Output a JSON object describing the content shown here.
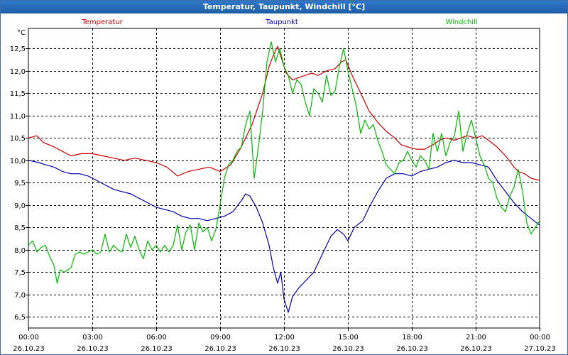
{
  "window": {
    "title": "Temperatur, Taupunkt, Windchill [°C]"
  },
  "chart_data": {
    "type": "line",
    "ylabel": "°C",
    "y_tick_labels": [
      "6,5",
      "7,0",
      "7,5",
      "8,0",
      "8,5",
      "9,0",
      "9,5",
      "10,0",
      "10,5",
      "11,0",
      "11,5",
      "12,0",
      "12,5"
    ],
    "y_ticks": [
      6.5,
      7.0,
      7.5,
      8.0,
      8.5,
      9.0,
      9.5,
      10.0,
      10.5,
      11.0,
      11.5,
      12.0,
      12.5
    ],
    "ylim": [
      6.25,
      12.95
    ],
    "xlim": [
      0,
      24
    ],
    "x_ticks": [
      0,
      3,
      6,
      9,
      12,
      15,
      18,
      21,
      24
    ],
    "x_tick_labels": [
      {
        "time": "00:00",
        "date": "26.10.23"
      },
      {
        "time": "03:00",
        "date": "26.10.23"
      },
      {
        "time": "06:00",
        "date": "26.10.23"
      },
      {
        "time": "09:00",
        "date": "26.10.23"
      },
      {
        "time": "12:00",
        "date": "26.10.23"
      },
      {
        "time": "15:00",
        "date": "26.10.23"
      },
      {
        "time": "18:00",
        "date": "26.10.23"
      },
      {
        "time": "21:00",
        "date": "26.10.23"
      },
      {
        "time": "00:00",
        "date": "27.10.23"
      }
    ],
    "grid": true,
    "legend_position": "top",
    "series": [
      {
        "name": "Temperatur",
        "color": "#cc0000",
        "points": [
          [
            0,
            10.5
          ],
          [
            0.4,
            10.55
          ],
          [
            0.7,
            10.4
          ],
          [
            1.2,
            10.3
          ],
          [
            1.6,
            10.2
          ],
          [
            2.0,
            10.1
          ],
          [
            2.5,
            10.15
          ],
          [
            3.0,
            10.15
          ],
          [
            3.5,
            10.1
          ],
          [
            4.0,
            10.05
          ],
          [
            4.5,
            10.0
          ],
          [
            5.0,
            10.05
          ],
          [
            5.5,
            10.0
          ],
          [
            6.0,
            9.95
          ],
          [
            6.5,
            9.85
          ],
          [
            7.0,
            9.65
          ],
          [
            7.5,
            9.75
          ],
          [
            8.0,
            9.8
          ],
          [
            8.5,
            9.85
          ],
          [
            9.0,
            9.75
          ],
          [
            9.5,
            9.9
          ],
          [
            10.0,
            10.3
          ],
          [
            10.5,
            10.8
          ],
          [
            11.0,
            11.5
          ],
          [
            11.3,
            12.1
          ],
          [
            11.5,
            12.35
          ],
          [
            11.7,
            12.55
          ],
          [
            11.9,
            12.25
          ],
          [
            12.1,
            11.95
          ],
          [
            12.4,
            11.8
          ],
          [
            12.7,
            11.85
          ],
          [
            13.0,
            11.9
          ],
          [
            13.3,
            11.95
          ],
          [
            13.6,
            11.9
          ],
          [
            14.0,
            12.0
          ],
          [
            14.4,
            12.05
          ],
          [
            14.7,
            12.2
          ],
          [
            14.9,
            12.25
          ],
          [
            15.2,
            11.9
          ],
          [
            15.6,
            11.5
          ],
          [
            16.0,
            11.1
          ],
          [
            16.4,
            10.85
          ],
          [
            16.8,
            10.65
          ],
          [
            17.2,
            10.5
          ],
          [
            17.5,
            10.35
          ],
          [
            17.8,
            10.3
          ],
          [
            18.2,
            10.25
          ],
          [
            18.6,
            10.25
          ],
          [
            19.0,
            10.35
          ],
          [
            19.3,
            10.45
          ],
          [
            19.6,
            10.5
          ],
          [
            20.0,
            10.45
          ],
          [
            20.3,
            10.5
          ],
          [
            20.6,
            10.55
          ],
          [
            21.0,
            10.5
          ],
          [
            21.3,
            10.55
          ],
          [
            21.6,
            10.45
          ],
          [
            22.0,
            10.3
          ],
          [
            22.4,
            10.1
          ],
          [
            22.8,
            9.85
          ],
          [
            23.0,
            9.75
          ],
          [
            23.3,
            9.7
          ],
          [
            23.6,
            9.6
          ],
          [
            24.0,
            9.55
          ]
        ]
      },
      {
        "name": "Taupunkt",
        "color": "#0000aa",
        "points": [
          [
            0,
            10.0
          ],
          [
            0.5,
            9.95
          ],
          [
            0.8,
            9.9
          ],
          [
            1.2,
            9.85
          ],
          [
            1.6,
            9.75
          ],
          [
            2.0,
            9.7
          ],
          [
            2.4,
            9.7
          ],
          [
            2.8,
            9.65
          ],
          [
            3.2,
            9.55
          ],
          [
            3.6,
            9.45
          ],
          [
            4.0,
            9.35
          ],
          [
            4.4,
            9.3
          ],
          [
            4.8,
            9.25
          ],
          [
            5.2,
            9.15
          ],
          [
            5.6,
            9.05
          ],
          [
            6.0,
            8.95
          ],
          [
            6.4,
            8.9
          ],
          [
            6.8,
            8.85
          ],
          [
            7.2,
            8.75
          ],
          [
            7.6,
            8.7
          ],
          [
            8.0,
            8.7
          ],
          [
            8.4,
            8.65
          ],
          [
            8.8,
            8.7
          ],
          [
            9.2,
            8.75
          ],
          [
            9.6,
            8.85
          ],
          [
            10.0,
            9.1
          ],
          [
            10.2,
            9.25
          ],
          [
            10.4,
            9.2
          ],
          [
            10.7,
            8.95
          ],
          [
            11.0,
            8.6
          ],
          [
            11.3,
            8.1
          ],
          [
            11.5,
            7.6
          ],
          [
            11.7,
            7.25
          ],
          [
            11.85,
            7.5
          ],
          [
            12.0,
            6.9
          ],
          [
            12.2,
            6.6
          ],
          [
            12.4,
            6.95
          ],
          [
            12.7,
            7.15
          ],
          [
            13.0,
            7.3
          ],
          [
            13.4,
            7.5
          ],
          [
            13.8,
            7.9
          ],
          [
            14.2,
            8.3
          ],
          [
            14.5,
            8.45
          ],
          [
            14.8,
            8.35
          ],
          [
            15.0,
            8.2
          ],
          [
            15.3,
            8.5
          ],
          [
            15.7,
            8.65
          ],
          [
            16.0,
            8.95
          ],
          [
            16.4,
            9.3
          ],
          [
            16.8,
            9.6
          ],
          [
            17.2,
            9.7
          ],
          [
            17.6,
            9.7
          ],
          [
            18.0,
            9.65
          ],
          [
            18.4,
            9.75
          ],
          [
            18.8,
            9.8
          ],
          [
            19.2,
            9.85
          ],
          [
            19.6,
            9.95
          ],
          [
            20.0,
            10.0
          ],
          [
            20.4,
            9.95
          ],
          [
            20.8,
            9.95
          ],
          [
            21.2,
            9.9
          ],
          [
            21.6,
            9.85
          ],
          [
            22.0,
            9.55
          ],
          [
            22.4,
            9.3
          ],
          [
            22.8,
            9.05
          ],
          [
            23.2,
            8.85
          ],
          [
            23.6,
            8.7
          ],
          [
            24.0,
            8.55
          ]
        ]
      },
      {
        "name": "Windchill",
        "color": "#00bb00",
        "points": [
          [
            0,
            8.1
          ],
          [
            0.2,
            8.2
          ],
          [
            0.4,
            7.95
          ],
          [
            0.6,
            8.05
          ],
          [
            0.8,
            8.1
          ],
          [
            1.0,
            7.85
          ],
          [
            1.2,
            7.65
          ],
          [
            1.35,
            7.25
          ],
          [
            1.5,
            7.55
          ],
          [
            1.7,
            7.5
          ],
          [
            2.0,
            7.6
          ],
          [
            2.2,
            7.9
          ],
          [
            2.4,
            7.95
          ],
          [
            2.6,
            7.9
          ],
          [
            2.8,
            7.95
          ],
          [
            3.0,
            8.0
          ],
          [
            3.2,
            7.9
          ],
          [
            3.4,
            7.95
          ],
          [
            3.6,
            8.35
          ],
          [
            3.8,
            7.95
          ],
          [
            4.0,
            8.1
          ],
          [
            4.2,
            8.0
          ],
          [
            4.4,
            7.95
          ],
          [
            4.6,
            8.35
          ],
          [
            4.8,
            8.05
          ],
          [
            5.0,
            8.3
          ],
          [
            5.2,
            8.0
          ],
          [
            5.4,
            7.8
          ],
          [
            5.6,
            8.2
          ],
          [
            5.8,
            8.0
          ],
          [
            6.0,
            8.1
          ],
          [
            6.2,
            7.95
          ],
          [
            6.4,
            8.1
          ],
          [
            6.6,
            7.95
          ],
          [
            6.8,
            8.1
          ],
          [
            7.0,
            8.55
          ],
          [
            7.2,
            8.0
          ],
          [
            7.4,
            8.4
          ],
          [
            7.6,
            8.55
          ],
          [
            7.8,
            8.0
          ],
          [
            8.0,
            8.6
          ],
          [
            8.2,
            8.4
          ],
          [
            8.4,
            8.5
          ],
          [
            8.6,
            8.2
          ],
          [
            8.8,
            8.45
          ],
          [
            9.0,
            9.0
          ],
          [
            9.2,
            9.6
          ],
          [
            9.4,
            9.9
          ],
          [
            9.6,
            10.0
          ],
          [
            9.8,
            10.2
          ],
          [
            10.0,
            10.3
          ],
          [
            10.2,
            10.8
          ],
          [
            10.4,
            11.1
          ],
          [
            10.6,
            9.6
          ],
          [
            10.8,
            10.3
          ],
          [
            11.0,
            11.1
          ],
          [
            11.2,
            12.2
          ],
          [
            11.4,
            12.65
          ],
          [
            11.6,
            12.2
          ],
          [
            11.8,
            12.5
          ],
          [
            12.0,
            12.1
          ],
          [
            12.2,
            11.9
          ],
          [
            12.4,
            11.5
          ],
          [
            12.6,
            11.8
          ],
          [
            12.8,
            11.7
          ],
          [
            13.0,
            11.3
          ],
          [
            13.2,
            11.0
          ],
          [
            13.4,
            11.6
          ],
          [
            13.6,
            11.5
          ],
          [
            13.8,
            11.3
          ],
          [
            14.0,
            11.9
          ],
          [
            14.2,
            11.45
          ],
          [
            14.4,
            11.55
          ],
          [
            14.6,
            12.1
          ],
          [
            14.8,
            12.5
          ],
          [
            15.0,
            12.0
          ],
          [
            15.2,
            11.6
          ],
          [
            15.4,
            11.2
          ],
          [
            15.6,
            10.6
          ],
          [
            15.8,
            10.9
          ],
          [
            16.0,
            10.7
          ],
          [
            16.2,
            10.8
          ],
          [
            16.4,
            10.45
          ],
          [
            16.6,
            10.2
          ],
          [
            16.8,
            9.9
          ],
          [
            17.0,
            9.8
          ],
          [
            17.2,
            9.7
          ],
          [
            17.4,
            9.95
          ],
          [
            17.6,
            10.0
          ],
          [
            17.8,
            10.2
          ],
          [
            18.0,
            10.0
          ],
          [
            18.2,
            9.85
          ],
          [
            18.4,
            10.1
          ],
          [
            18.6,
            10.0
          ],
          [
            18.8,
            9.8
          ],
          [
            19.0,
            10.6
          ],
          [
            19.2,
            10.2
          ],
          [
            19.4,
            10.6
          ],
          [
            19.6,
            10.1
          ],
          [
            19.8,
            10.4
          ],
          [
            20.0,
            10.55
          ],
          [
            20.2,
            11.1
          ],
          [
            20.4,
            10.2
          ],
          [
            20.6,
            10.6
          ],
          [
            20.8,
            10.9
          ],
          [
            21.0,
            10.5
          ],
          [
            21.2,
            10.1
          ],
          [
            21.4,
            9.9
          ],
          [
            21.6,
            9.6
          ],
          [
            21.8,
            9.5
          ],
          [
            22.0,
            9.15
          ],
          [
            22.2,
            8.95
          ],
          [
            22.4,
            8.85
          ],
          [
            22.6,
            9.2
          ],
          [
            22.8,
            9.4
          ],
          [
            23.0,
            9.8
          ],
          [
            23.2,
            9.3
          ],
          [
            23.4,
            8.6
          ],
          [
            23.6,
            8.35
          ],
          [
            23.8,
            8.5
          ],
          [
            24.0,
            8.65
          ]
        ]
      }
    ]
  }
}
